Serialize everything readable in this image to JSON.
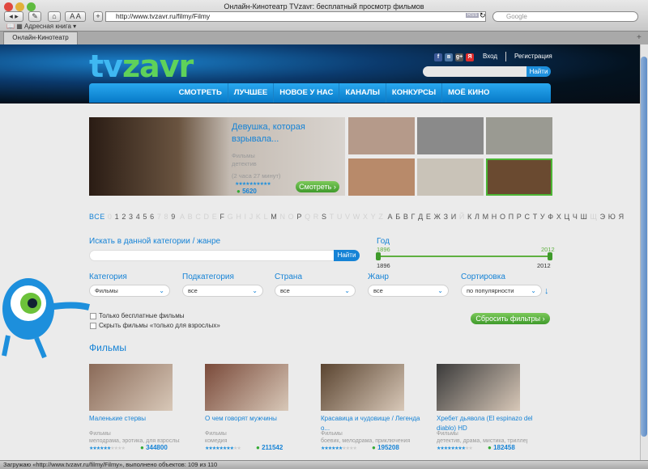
{
  "window": {
    "title": "Онлайн-Кинотеатр TVzavr: бесплатный просмотр фильмов",
    "url": "http://www.tvzavr.ru/filmy/Filmy",
    "search_placeholder": "Google",
    "rss": "RSS",
    "bookmarks_label": "Адресная книга ▾",
    "tab_title": "Онлайн-Кинотеатр TVzavr: бесп...",
    "status": "Загружаю «http://www.tvzavr.ru/filmy/Filmy», выполнено объектов: 109 из 110"
  },
  "header": {
    "logo": "tvzavr",
    "login": "Вход",
    "register": "Регистрация",
    "find": "Найти",
    "social": [
      "f",
      "в",
      "g+",
      "Я"
    ]
  },
  "nav": [
    "СМОТРЕТЬ",
    "ЛУЧШЕЕ",
    "НОВОЕ У НАС",
    "КАНАЛЫ",
    "КОНКУРСЫ",
    "МОЁ КИНО"
  ],
  "hero": {
    "title": "Девушка, которая взрывала...",
    "category": "Фильмы",
    "genre": "детектив",
    "duration": "(2 часа 27 минут)",
    "views": "5620",
    "watch": "Смотреть"
  },
  "alphabet": {
    "all": "ВСЕ",
    "letters": [
      "0",
      "1",
      "2",
      "3",
      "4",
      "5",
      "6",
      "7",
      "8",
      "9",
      "A",
      "B",
      "C",
      "D",
      "E",
      "F",
      "G",
      "H",
      "I",
      "J",
      "K",
      "L",
      "M",
      "N",
      "O",
      "P",
      "Q",
      "R",
      "S",
      "T",
      "U",
      "V",
      "W",
      "X",
      "Y",
      "Z",
      "А",
      "Б",
      "В",
      "Г",
      "Д",
      "Е",
      "Ж",
      "З",
      "И",
      "Й",
      "К",
      "Л",
      "М",
      "Н",
      "О",
      "П",
      "Р",
      "С",
      "Т",
      "У",
      "Ф",
      "Х",
      "Ц",
      "Ч",
      "Ш",
      "Щ",
      "Э",
      "Ю",
      "Я"
    ],
    "dim": [
      "0",
      "7",
      "8",
      "A",
      "B",
      "C",
      "D",
      "E",
      "G",
      "H",
      "I",
      "J",
      "K",
      "L",
      "N",
      "O",
      "Q",
      "R",
      "T",
      "U",
      "V",
      "W",
      "X",
      "Y",
      "Z",
      "Й",
      "Щ"
    ]
  },
  "filters": {
    "search_label": "Искать в данной категории / жанре",
    "find": "Найти",
    "year_label": "Год",
    "year_from": "1896",
    "year_to": "2012",
    "selects": [
      {
        "label": "Категория",
        "value": "Фильмы"
      },
      {
        "label": "Подкатегория",
        "value": "все"
      },
      {
        "label": "Страна",
        "value": "все"
      },
      {
        "label": "Жанр",
        "value": "все"
      },
      {
        "label": "Сортировка",
        "value": "по популярности"
      }
    ],
    "free_only": "Только бесплатные фильмы",
    "hide_adult": "Скрыть фильмы «только для взрослых»",
    "reset": "Сбросить фильтры"
  },
  "section_title": "Фильмы",
  "movies": [
    {
      "title": "Маленькие стервы",
      "category": "Фильмы",
      "genres": "мелодрама, эротика, для взрослых",
      "rating": 6,
      "views": "344800",
      "color": "#8a6a58"
    },
    {
      "title": "О чем говорят мужчины",
      "category": "Фильмы",
      "genres": "комедия",
      "rating": 8,
      "views": "211542",
      "color": "#7a4a3a"
    },
    {
      "title": "Красавица и чудовище / Легенда о...",
      "category": "Фильмы",
      "genres": "боевик, мелодрама, приключения",
      "rating": 6,
      "views": "195208",
      "color": "#5a4430"
    },
    {
      "title": "Хребет дьявола (El espinazo del diablo) HD",
      "category": "Фильмы",
      "genres": "детектив, драма, мистика, триллер",
      "rating": 8,
      "views": "182458",
      "color": "#3a3a3a"
    }
  ]
}
